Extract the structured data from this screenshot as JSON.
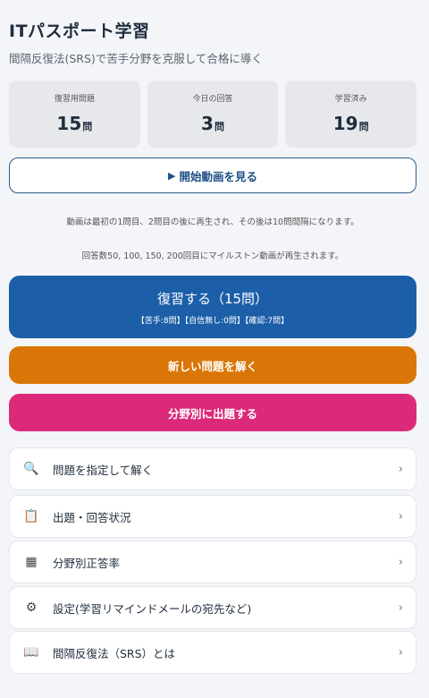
{
  "header": {
    "title": "ITパスポート学習",
    "subtitle": "間隔反復法(SRS)で苦手分野を克服して合格に導く"
  },
  "stats": [
    {
      "label": "復習用問題",
      "value": "15",
      "unit": "問"
    },
    {
      "label": "今日の回答",
      "value": "3",
      "unit": "問"
    },
    {
      "label": "学習済み",
      "value": "19",
      "unit": "問"
    }
  ],
  "video_button": {
    "icon": "▶",
    "label": "開始動画を見る"
  },
  "notes": {
    "line1": "動画は最初の1問目、2問目の後に再生され、その後は10問間隔になります。",
    "line2": "回答数50, 100, 150, 200回目にマイルストン動画が再生されます。"
  },
  "review_button": {
    "label": "復習する（15問）",
    "detail": "【苦手:8問】【自信無し:0問】【確認:7問】"
  },
  "new_button": {
    "label": "新しい問題を解く"
  },
  "field_button": {
    "label": "分野別に出題する"
  },
  "menu": [
    {
      "icon": "🔍",
      "icon_name": "search-icon",
      "label": "問題を指定して解く"
    },
    {
      "icon": "📋",
      "icon_name": "clipboard-icon",
      "label": "出題・回答状況"
    },
    {
      "icon": "▦",
      "icon_name": "grid-icon",
      "label": "分野別正答率"
    },
    {
      "icon": "⚙",
      "icon_name": "gear-icon",
      "label": "設定(学習リマインドメールの宛先など)"
    },
    {
      "icon": "📖",
      "icon_name": "book-icon",
      "label": "間隔反復法（SRS）とは"
    }
  ],
  "chevron": "›",
  "colors": {
    "review": "#1c5fa8",
    "new": "#d97607",
    "field": "#dc2a7a",
    "outline": "#2a5d94"
  }
}
